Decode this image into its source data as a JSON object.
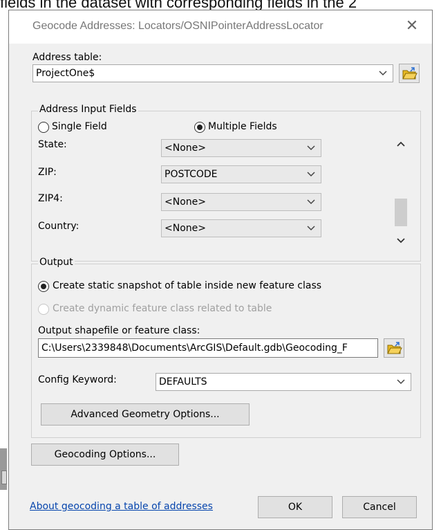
{
  "background": {
    "top_text": "fields in the dataset with corresponding fields in the 2"
  },
  "dialog": {
    "title": "Geocode Addresses:  Locators/OSNIPointerAddressLocator",
    "close_glyph": "✕",
    "address_table": {
      "label": "Address table:",
      "value": "ProjectOne$"
    },
    "address_input_fields": {
      "group_title": "Address Input Fields",
      "single_field_label": "Single Field",
      "multiple_fields_label": "Multiple Fields",
      "selected": "Multiple Fields",
      "fields": [
        {
          "label": "State:",
          "value": "<None>"
        },
        {
          "label": "ZIP:",
          "value": "POSTCODE"
        },
        {
          "label": "ZIP4:",
          "value": "<None>"
        },
        {
          "label": "Country:",
          "value": "<None>"
        }
      ]
    },
    "output": {
      "group_title": "Output",
      "static_option": "Create static snapshot of table inside new feature class",
      "dynamic_option": "Create dynamic feature class related to table",
      "selected": "static",
      "output_label": "Output shapefile or feature class:",
      "output_value": "C:\\Users\\2339848\\Documents\\ArcGIS\\Default.gdb\\Geocoding_F",
      "config_label": "Config Keyword:",
      "config_value": "DEFAULTS",
      "advanced_button": "Advanced Geometry Options..."
    },
    "geocoding_options_button": "Geocoding Options...",
    "about_link": "About geocoding a table of addresses",
    "ok_button": "OK",
    "cancel_button": "Cancel"
  },
  "colors": {
    "dialog_bg": "#f0f0f0",
    "link": "#0645ad",
    "folder_icon": "#e8b923"
  },
  "icons": [
    "close-icon",
    "chevron-down-icon",
    "folder-open-icon",
    "scroll-up-icon",
    "scroll-down-icon"
  ]
}
